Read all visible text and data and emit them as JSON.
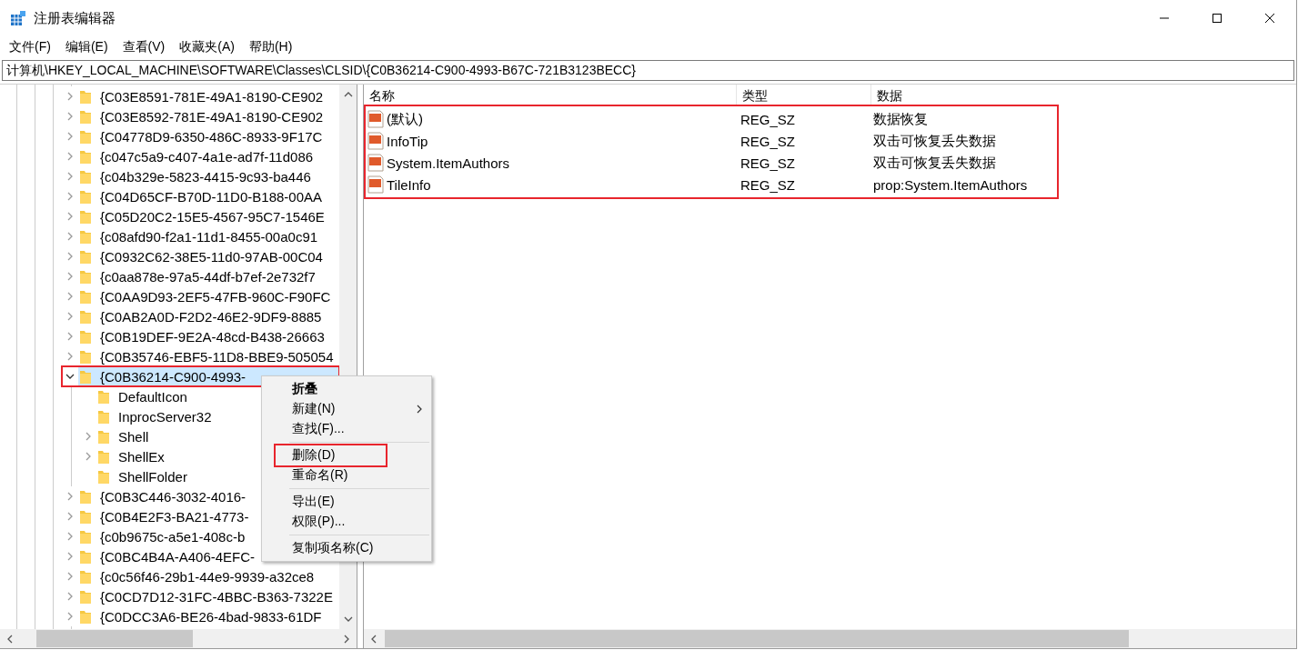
{
  "window": {
    "title": "注册表编辑器"
  },
  "menu_bar": [
    "文件(F)",
    "编辑(E)",
    "查看(V)",
    "收藏夹(A)",
    "帮助(H)"
  ],
  "address": "计算机\\HKEY_LOCAL_MACHINE\\SOFTWARE\\Classes\\CLSID\\{C0B36214-C900-4993-B67C-721B3123BECC}",
  "tree": {
    "items": [
      {
        "label": "{C03E8591-781E-49A1-8190-CE902",
        "has_children": true,
        "expanded": false,
        "selected": false,
        "highlighted": false
      },
      {
        "label": "{C03E8592-781E-49A1-8190-CE902",
        "has_children": true,
        "expanded": false,
        "selected": false,
        "highlighted": false
      },
      {
        "label": "{C04778D9-6350-486C-8933-9F17C",
        "has_children": true,
        "expanded": false,
        "selected": false,
        "highlighted": false
      },
      {
        "label": "{c047c5a9-c407-4a1e-ad7f-11d086",
        "has_children": true,
        "expanded": false,
        "selected": false,
        "highlighted": false
      },
      {
        "label": "{c04b329e-5823-4415-9c93-ba446",
        "has_children": true,
        "expanded": false,
        "selected": false,
        "highlighted": false
      },
      {
        "label": "{C04D65CF-B70D-11D0-B188-00AA",
        "has_children": true,
        "expanded": false,
        "selected": false,
        "highlighted": false
      },
      {
        "label": "{C05D20C2-15E5-4567-95C7-1546E",
        "has_children": true,
        "expanded": false,
        "selected": false,
        "highlighted": false
      },
      {
        "label": "{c08afd90-f2a1-11d1-8455-00a0c91",
        "has_children": true,
        "expanded": false,
        "selected": false,
        "highlighted": false
      },
      {
        "label": "{C0932C62-38E5-11d0-97AB-00C04",
        "has_children": true,
        "expanded": false,
        "selected": false,
        "highlighted": false
      },
      {
        "label": "{c0aa878e-97a5-44df-b7ef-2e732f7",
        "has_children": true,
        "expanded": false,
        "selected": false,
        "highlighted": false
      },
      {
        "label": "{C0AA9D93-2EF5-47FB-960C-F90FC",
        "has_children": true,
        "expanded": false,
        "selected": false,
        "highlighted": false
      },
      {
        "label": "{C0AB2A0D-F2D2-46E2-9DF9-8885",
        "has_children": true,
        "expanded": false,
        "selected": false,
        "highlighted": false
      },
      {
        "label": "{C0B19DEF-9E2A-48cd-B438-26663",
        "has_children": true,
        "expanded": false,
        "selected": false,
        "highlighted": false
      },
      {
        "label": "{C0B35746-EBF5-11D8-BBE9-505054",
        "has_children": true,
        "expanded": false,
        "selected": false,
        "highlighted": false
      },
      {
        "label": "{C0B36214-C900-4993-",
        "has_children": true,
        "expanded": true,
        "selected": true,
        "highlighted": true,
        "children": [
          {
            "label": "DefaultIcon",
            "has_children": false,
            "expanded": false,
            "selected": false,
            "highlighted": false
          },
          {
            "label": "InprocServer32",
            "has_children": false,
            "expanded": false,
            "selected": false,
            "highlighted": false
          },
          {
            "label": "Shell",
            "has_children": true,
            "expanded": false,
            "selected": false,
            "highlighted": false
          },
          {
            "label": "ShellEx",
            "has_children": true,
            "expanded": false,
            "selected": false,
            "highlighted": false
          },
          {
            "label": "ShellFolder",
            "has_children": false,
            "expanded": false,
            "selected": false,
            "highlighted": false
          }
        ]
      },
      {
        "label": "{C0B3C446-3032-4016-",
        "has_children": true,
        "expanded": false,
        "selected": false,
        "highlighted": false
      },
      {
        "label": "{C0B4E2F3-BA21-4773-",
        "has_children": true,
        "expanded": false,
        "selected": false,
        "highlighted": false
      },
      {
        "label": "{c0b9675c-a5e1-408c-b",
        "has_children": true,
        "expanded": false,
        "selected": false,
        "highlighted": false
      },
      {
        "label": "{C0BC4B4A-A406-4EFC-",
        "has_children": true,
        "expanded": false,
        "selected": false,
        "highlighted": false
      },
      {
        "label": "{c0c56f46-29b1-44e9-9939-a32ce8",
        "has_children": true,
        "expanded": false,
        "selected": false,
        "highlighted": false
      },
      {
        "label": "{C0CD7D12-31FC-4BBC-B363-7322E",
        "has_children": true,
        "expanded": false,
        "selected": false,
        "highlighted": false
      },
      {
        "label": "{C0DCC3A6-BE26-4bad-9833-61DF",
        "has_children": true,
        "expanded": false,
        "selected": false,
        "highlighted": false
      }
    ]
  },
  "values": {
    "highlighted": true,
    "columns": [
      "名称",
      "类型",
      "数据"
    ],
    "rows": [
      {
        "name": "(默认)",
        "type": "REG_SZ",
        "data": "数据恢复"
      },
      {
        "name": "InfoTip",
        "type": "REG_SZ",
        "data": "双击可恢复丢失数据"
      },
      {
        "name": "System.ItemAuthors",
        "type": "REG_SZ",
        "data": "双击可恢复丢失数据"
      },
      {
        "name": "TileInfo",
        "type": "REG_SZ",
        "data": "prop:System.ItemAuthors"
      }
    ]
  },
  "context_menu": {
    "items": [
      {
        "kind": "item",
        "label": "折叠",
        "bold": true,
        "submenu": false,
        "highlighted": false
      },
      {
        "kind": "item",
        "label": "新建(N)",
        "bold": false,
        "submenu": true,
        "highlighted": false
      },
      {
        "kind": "item",
        "label": "查找(F)...",
        "bold": false,
        "submenu": false,
        "highlighted": false
      },
      {
        "kind": "separator"
      },
      {
        "kind": "item",
        "label": "删除(D)",
        "bold": false,
        "submenu": false,
        "highlighted": true
      },
      {
        "kind": "item",
        "label": "重命名(R)",
        "bold": false,
        "submenu": false,
        "highlighted": false
      },
      {
        "kind": "separator"
      },
      {
        "kind": "item",
        "label": "导出(E)",
        "bold": false,
        "submenu": false,
        "highlighted": false
      },
      {
        "kind": "item",
        "label": "权限(P)...",
        "bold": false,
        "submenu": false,
        "highlighted": false
      },
      {
        "kind": "separator"
      },
      {
        "kind": "item",
        "label": "复制项名称(C)",
        "bold": false,
        "submenu": false,
        "highlighted": false
      }
    ]
  }
}
